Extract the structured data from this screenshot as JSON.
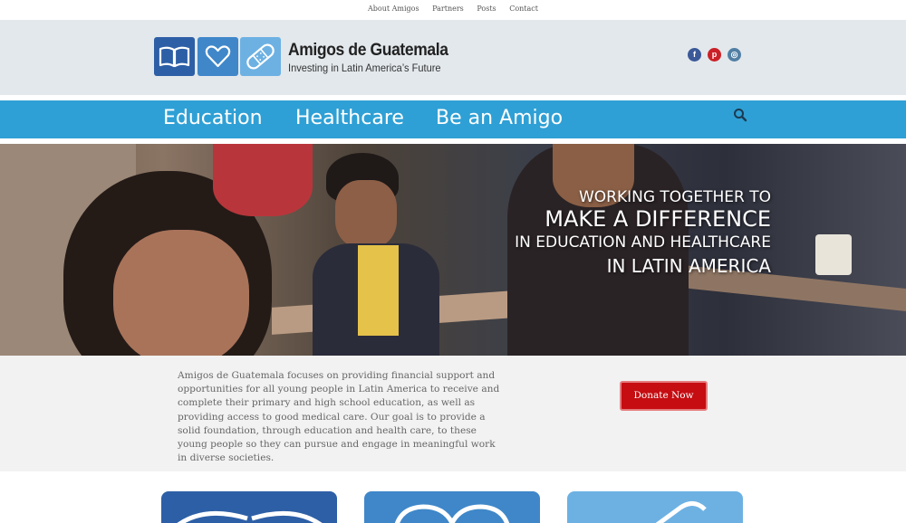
{
  "top_nav": {
    "links": [
      "About Amigos",
      "Partners",
      "Posts",
      "Contact"
    ]
  },
  "brand": {
    "title": "Amigos de Guatemala",
    "tagline": "Investing in Latin America’s Future",
    "logo_icons": [
      "book-icon",
      "heart-icon",
      "bandage-icon"
    ]
  },
  "social": {
    "facebook": "f",
    "pinterest": "p",
    "instagram": "◎"
  },
  "main_nav": {
    "items": [
      "Education",
      "Healthcare",
      "Be an Amigo"
    ]
  },
  "hero": {
    "line1": "WORKING TOGETHER TO",
    "line2": "MAKE A DIFFERENCE",
    "line3": "IN EDUCATION AND HEALTHCARE",
    "line4": "IN LATIN AMERICA"
  },
  "intro": {
    "text": "Amigos de Guatemala focuses on providing financial support and opportunities for all young people in Latin America to receive and complete their primary and high school education, as well as providing access to good medical care. Our goal is to provide a solid foundation, through education and health care, to these young people so they can pursue and engage in meaningful work in diverse societies.",
    "donate_label": "Donate Now"
  },
  "colors": {
    "nav_blue": "#2fa0d5",
    "logo_dark": "#2d5fa6",
    "logo_mid": "#3f87c9",
    "logo_light": "#6db1e3",
    "donate_red": "#c50d12",
    "facebook": "#3b5998",
    "pinterest": "#cb2027",
    "instagram": "#517fa4"
  }
}
